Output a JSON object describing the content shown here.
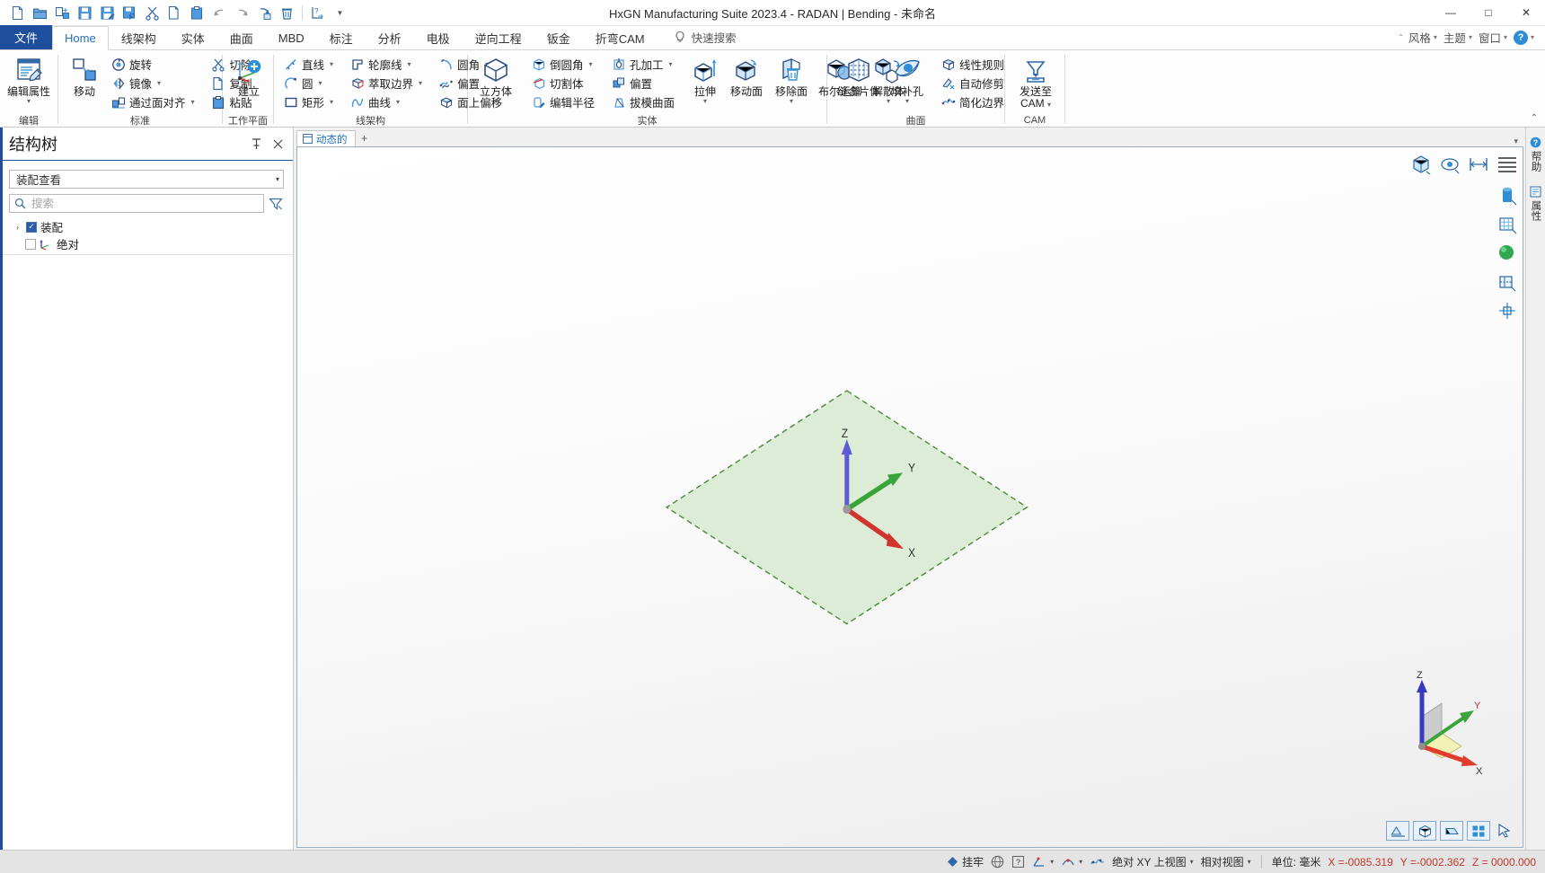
{
  "window": {
    "title": "HxGN Manufacturing Suite 2023.4 - RADAN | Bending - 未命名",
    "minimize": "—",
    "maximize": "□",
    "close": "✕"
  },
  "quick_access": {
    "items": [
      {
        "name": "new-file-icon",
        "tooltip": "新建"
      },
      {
        "name": "open-folder-icon",
        "tooltip": "打开"
      },
      {
        "name": "import-icon",
        "tooltip": "导入"
      },
      {
        "name": "save-icon",
        "tooltip": "保存"
      },
      {
        "name": "save-as-icon",
        "tooltip": "另存为"
      },
      {
        "name": "export-icon",
        "tooltip": "导出"
      },
      {
        "name": "cut-icon",
        "tooltip": "剪切"
      },
      {
        "name": "copy-icon",
        "tooltip": "复制"
      },
      {
        "name": "paste-icon",
        "tooltip": "粘贴"
      },
      {
        "name": "undo-icon",
        "tooltip": "撤销"
      },
      {
        "name": "redo-icon",
        "tooltip": "重做"
      },
      {
        "name": "repeat-icon",
        "tooltip": "重复"
      },
      {
        "name": "delete-icon",
        "tooltip": "删除"
      },
      {
        "name": "measure-icon",
        "tooltip": "测量"
      }
    ],
    "overflow_caret": "▼"
  },
  "ribbon": {
    "tabs": [
      {
        "label": "文件",
        "id": "file",
        "active": false,
        "special": true
      },
      {
        "label": "Home",
        "id": "home",
        "active": true
      },
      {
        "label": "线架构",
        "id": "wireframe",
        "active": false
      },
      {
        "label": "实体",
        "id": "solid",
        "active": false
      },
      {
        "label": "曲面",
        "id": "surface",
        "active": false
      },
      {
        "label": "MBD",
        "id": "mbd",
        "active": false
      },
      {
        "label": "标注",
        "id": "annotation",
        "active": false
      },
      {
        "label": "分析",
        "id": "analysis",
        "active": false
      },
      {
        "label": "电极",
        "id": "electrode",
        "active": false
      },
      {
        "label": "逆向工程",
        "id": "reverse-engineering",
        "active": false
      },
      {
        "label": "钣金",
        "id": "sheet-metal",
        "active": false
      },
      {
        "label": "折弯CAM",
        "id": "bending-cam",
        "active": false
      }
    ],
    "quick_search": {
      "label": "快速搜索",
      "icon": "lightbulb-icon"
    },
    "right_items": [
      {
        "label": "风格",
        "caret": "▾"
      },
      {
        "label": "主题",
        "caret": "▾"
      },
      {
        "label": "窗口",
        "caret": "▾"
      }
    ],
    "collapse_caret": "⌃",
    "help_label": "?",
    "collapse_ribbon": "⌃",
    "groups": [
      {
        "title": "编辑",
        "big": [
          {
            "label": "编辑属性",
            "icon": "edit-properties-icon",
            "caret": "▾"
          }
        ]
      },
      {
        "title": "标准",
        "big": [
          {
            "label": "移动",
            "icon": "move-icon",
            "caret": ""
          }
        ],
        "cols": [
          [
            {
              "label": "旋转",
              "icon": "rotate-icon",
              "caret": ""
            },
            {
              "label": "镜像",
              "icon": "mirror-icon",
              "caret": "▾"
            },
            {
              "label": "通过面对齐",
              "icon": "align-by-face-icon",
              "caret": "▾"
            }
          ],
          [
            {
              "label": "切除",
              "icon": "scissors-cut-icon",
              "caret": ""
            },
            {
              "label": "复制",
              "icon": "copy-page-icon",
              "caret": ""
            },
            {
              "label": "粘贴",
              "icon": "paste-clipboard-icon",
              "caret": ""
            }
          ]
        ]
      },
      {
        "title": "工作平面",
        "big": [
          {
            "label": "建立",
            "icon": "create-workplane-icon",
            "caret": "▾"
          }
        ]
      },
      {
        "title": "线架构",
        "cols": [
          [
            {
              "label": "直线",
              "icon": "line-icon",
              "caret": "▾"
            },
            {
              "label": "圆",
              "icon": "circle-icon",
              "caret": "▾"
            },
            {
              "label": "矩形",
              "icon": "rectangle-icon",
              "caret": "▾"
            }
          ],
          [
            {
              "label": "轮廓线",
              "icon": "profile-line-icon",
              "caret": "▾"
            },
            {
              "label": "萃取边界",
              "icon": "extract-boundary-icon",
              "caret": "▾"
            },
            {
              "label": "曲线",
              "icon": "curve-icon",
              "caret": "▾"
            }
          ],
          [
            {
              "label": "圆角",
              "icon": "fillet-icon",
              "caret": "▾"
            },
            {
              "label": "偏置",
              "icon": "offset-icon",
              "caret": ""
            },
            {
              "label": "面上偏移",
              "icon": "offset-on-face-icon",
              "caret": ""
            }
          ]
        ]
      },
      {
        "title": "实体",
        "big": [
          {
            "label": "立方体",
            "icon": "cube-icon",
            "caret": "▾"
          }
        ],
        "cols": [
          [
            {
              "label": "倒圆角",
              "icon": "round-corner-icon",
              "caret": "▾"
            },
            {
              "label": "切割体",
              "icon": "cut-body-icon",
              "caret": ""
            },
            {
              "label": "编辑半径",
              "icon": "edit-radius-icon",
              "caret": ""
            }
          ],
          [
            {
              "label": "孔加工",
              "icon": "hole-machining-icon",
              "caret": "▾"
            },
            {
              "label": "偏置",
              "icon": "offset-solid-icon",
              "caret": ""
            },
            {
              "label": "拔模曲面",
              "icon": "draft-surface-icon",
              "caret": ""
            }
          ]
        ],
        "big2": [
          {
            "label": "拉伸",
            "icon": "extrude-icon",
            "caret": "▾"
          },
          {
            "label": "移动面",
            "icon": "move-face-icon",
            "caret": ""
          },
          {
            "label": "移除面",
            "icon": "remove-face-icon",
            "caret": "▾"
          },
          {
            "label": "布尔运算",
            "icon": "boolean-icon",
            "caret": ""
          },
          {
            "label": "解散体",
            "icon": "dissolve-body-icon",
            "caret": "▾"
          }
        ]
      },
      {
        "title": "曲面",
        "big": [
          {
            "label": "缝合片体",
            "icon": "stitch-sheet-icon",
            "caret": ""
          },
          {
            "label": "填补孔",
            "icon": "fill-hole-icon",
            "caret": "▾"
          }
        ],
        "cols": [
          [
            {
              "label": "线性规则",
              "icon": "linear-rule-icon",
              "caret": ""
            },
            {
              "label": "自动修剪",
              "icon": "auto-trim-icon",
              "caret": ""
            },
            {
              "label": "简化边界",
              "icon": "simplify-boundary-icon",
              "caret": ""
            }
          ]
        ]
      },
      {
        "title": "CAM",
        "big": [
          {
            "label": "发送至",
            "label2": "CAM",
            "icon": "send-to-cam-icon",
            "caret": "▾"
          }
        ]
      }
    ]
  },
  "sidebar": {
    "title": "结构树",
    "pin_icon": "pin-icon",
    "close_icon": "close-icon",
    "view_selector": {
      "value": "装配查看",
      "caret": "▾"
    },
    "search": {
      "placeholder": "搜索",
      "value": "",
      "icon": "search-icon"
    },
    "filter_icon": "filter-icon",
    "tree": [
      {
        "label": "装配",
        "expander": "›",
        "checked": true,
        "indent": 0,
        "icon": ""
      },
      {
        "label": "绝对",
        "expander": "",
        "checked": false,
        "indent": 1,
        "icon": "workplane-icon"
      }
    ]
  },
  "viewport": {
    "tabs": [
      {
        "label": "动态的",
        "icon": "view-tab-icon",
        "active": true
      }
    ],
    "add_tab": "+",
    "overflow_caret": "▾",
    "top_tools": [
      {
        "name": "isometric-view-icon"
      },
      {
        "name": "rotate-view-icon"
      },
      {
        "name": "fit-view-icon"
      },
      {
        "name": "menu-lines-icon"
      }
    ],
    "rail_tools": [
      {
        "name": "cylinder-shade-icon"
      },
      {
        "name": "wireframe-shade-icon"
      },
      {
        "name": "shaded-sphere-icon"
      },
      {
        "name": "section-view-icon"
      },
      {
        "name": "origin-axis-icon"
      }
    ],
    "bottom_tools": [
      {
        "name": "view-front-icon"
      },
      {
        "name": "view-iso-icon"
      },
      {
        "name": "view-top-icon"
      },
      {
        "name": "view-grid-icon"
      },
      {
        "name": "view-cursor-icon"
      }
    ],
    "workplane": {
      "axis_x_label": "X",
      "axis_y_label": "Y",
      "axis_z_label": "Z",
      "fill_color": "#d9ead3",
      "border_color": "#4e8a3a"
    },
    "triad": {
      "axis_x_label": "X",
      "axis_y_label": "Y",
      "axis_z_label": "Z"
    }
  },
  "right_dock": [
    {
      "label": "帮助",
      "icon": "help-icon"
    },
    {
      "label": "属性",
      "icon": "properties-icon"
    }
  ],
  "statusbar": {
    "items": [
      {
        "name": "snap-diamond-icon",
        "label": "挂牢"
      },
      {
        "name": "globe-icon",
        "label": ""
      },
      {
        "name": "question-icon",
        "label": ""
      },
      {
        "name": "snap-grid-icon",
        "label": "",
        "caret": "▾"
      },
      {
        "name": "snap-point-icon",
        "label": "",
        "caret": "▾"
      },
      {
        "name": "snap-curve-icon",
        "label": ""
      }
    ],
    "view_mode": {
      "label": "绝对 XY 上视图",
      "caret": "▾"
    },
    "relative_view": {
      "label": "相对视图",
      "caret": "▾"
    },
    "units": {
      "label": "单位: 毫米"
    },
    "coords": {
      "x": "X =-0085.319",
      "y": "Y =-0002.362",
      "z": "Z = 0000.000"
    },
    "color_accent": "#c0392b"
  }
}
